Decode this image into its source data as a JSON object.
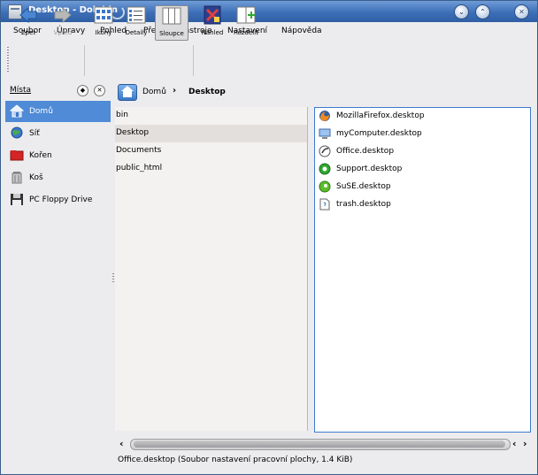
{
  "window": {
    "title": "Desktop - Dolphin"
  },
  "menubar": {
    "items": [
      {
        "label": "Soubor"
      },
      {
        "label": "Úpravy"
      },
      {
        "label": "Pohled"
      },
      {
        "label": "Přejít"
      },
      {
        "label": "Nástroje"
      },
      {
        "label": "Nastavení"
      },
      {
        "label": "Nápověda"
      }
    ]
  },
  "toolbar": {
    "back": "Zpet",
    "forward": "Vpred",
    "icons": "Ikony",
    "details": "Detaily",
    "columns": "Sloupce",
    "preview": "Nahled",
    "split": "Rozdelit"
  },
  "places": {
    "title": "Místa",
    "items": [
      {
        "label": "Domů",
        "icon": "home-icon",
        "selected": true
      },
      {
        "label": "Síť",
        "icon": "network-icon",
        "selected": false
      },
      {
        "label": "Kořen",
        "icon": "root-folder-icon",
        "selected": false
      },
      {
        "label": "Koš",
        "icon": "trash-icon",
        "selected": false
      },
      {
        "label": "PC Floppy Drive",
        "icon": "floppy-icon",
        "selected": false
      }
    ]
  },
  "breadcrumb": {
    "home": "Domů",
    "current": "Desktop"
  },
  "column1": {
    "items": [
      {
        "label": "bin",
        "selected": false
      },
      {
        "label": "Desktop",
        "selected": true
      },
      {
        "label": "Documents",
        "selected": false
      },
      {
        "label": "public_html",
        "selected": false
      }
    ]
  },
  "column2": {
    "items": [
      {
        "label": "MozillaFirefox.desktop",
        "icon": "firefox-icon"
      },
      {
        "label": "myComputer.desktop",
        "icon": "computer-icon"
      },
      {
        "label": "Office.desktop",
        "icon": "office-icon"
      },
      {
        "label": "Support.desktop",
        "icon": "support-icon"
      },
      {
        "label": "SuSE.desktop",
        "icon": "suse-icon"
      },
      {
        "label": "trash.desktop",
        "icon": "desktop-file-icon"
      }
    ]
  },
  "statusbar": {
    "text": "Office.desktop (Soubor nastavení pracovní plochy, 1.4 KiB)"
  },
  "colors": {
    "accent": "#4f8bd6",
    "titlebar": "#3d6fb8",
    "selection": "#e3dfdc"
  }
}
